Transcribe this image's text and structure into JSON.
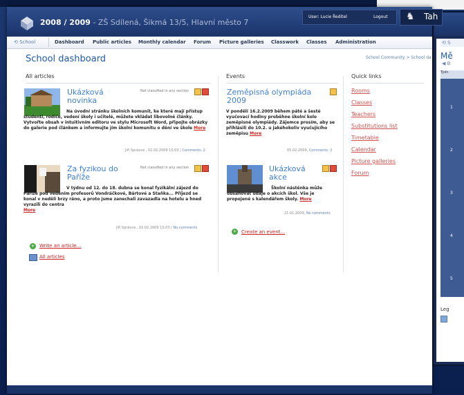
{
  "header": {
    "year": "2008 / 2009",
    "location": " - ZŠ Sdílená, Šikmá 13/5, Hlavní město 7",
    "user_label": "User: Lucie Ředitel",
    "logout_label": "Logout",
    "brand_text": "Tah"
  },
  "nav": {
    "home": "School",
    "items": [
      "Dashboard",
      "Public articles",
      "Monthly calendar",
      "Forum",
      "Picture galleries",
      "Classwork",
      "Classes",
      "Administration"
    ]
  },
  "page": {
    "title": "School dashboard",
    "breadcrumb": "School Community > School da"
  },
  "articles": {
    "heading": "All articles",
    "items": [
      {
        "title_line1": "Ukázková",
        "title_line2": "novinka",
        "category": "Not classified in any section",
        "body": "Na úvodní stránku školních komunit, ke které mají přístup studenti, rodiče, vedení školy i učitelé, můžete vkládat libovolné články. Vytvořte obsah v intuitivním editoru ve stylu Microsoft Word, připojte obrázky do galerie pod článkem a informujte jím školní komunitu o dění ve škole",
        "more": "More",
        "meta": "Jiří Správce , 02.02.2009 15:03 | ",
        "comments": "Comments: 2"
      },
      {
        "title_line1": "Za fyzikou do",
        "title_line2": "Paříže",
        "category": "Not classified in any section",
        "body": "V týdnu od 12. do 18. dubna se konal fyzikální zájezd do Paříže pod vedením profesorů Vondráčkové, Bártové a Staňka... Příjezd se konal v neděli brzy ráno, a proto jsme zanechali zavazadla na hotelu a hned vyrazili do centra",
        "more": "More",
        "meta": "Jiří Správce , 02.02.2009 15:03 | ",
        "comments": "No comments"
      }
    ],
    "write_link": "Write an article...",
    "all_link": "All articles"
  },
  "events": {
    "heading": "Events",
    "items": [
      {
        "title_line1": "Zeměpisná olympiáda",
        "title_line2": "2009",
        "body": "V pondělí 16.2.2009 během páté a šesté vyučovací hodiny proběhne školní kolo zeměpisné olympiády. Zájemce prosím, aby se přihlásili do 10.2. u jakéhokoliv vyučujícího zeměpisu",
        "more": "More",
        "meta": "05.02.2009, ",
        "comments": "Comments: 2"
      },
      {
        "title_line1": "Ukázková",
        "title_line2": "akce",
        "body": "Školní nástěnka může obsahovat údaje o akcích škol. Vše je propojené s kalendářem školy.",
        "more": "More",
        "meta": "21.01.2009, ",
        "comments": "No comments"
      }
    ],
    "create_link": "Create an event..."
  },
  "quick_links": {
    "heading": "Quick links",
    "items": [
      "Rooms",
      "Classes",
      "Teachers",
      "Substitutions list",
      "Timetable",
      "Calendar",
      "Picture galleries",
      "Forum"
    ]
  },
  "background_window": {
    "title": "Mě",
    "nav_icon": "⟲ S",
    "back_icon": "◀ B",
    "header_label": "Týdn",
    "row_numbers": [
      "1",
      "2",
      "3",
      "4",
      "5"
    ],
    "legend": "Leg"
  }
}
